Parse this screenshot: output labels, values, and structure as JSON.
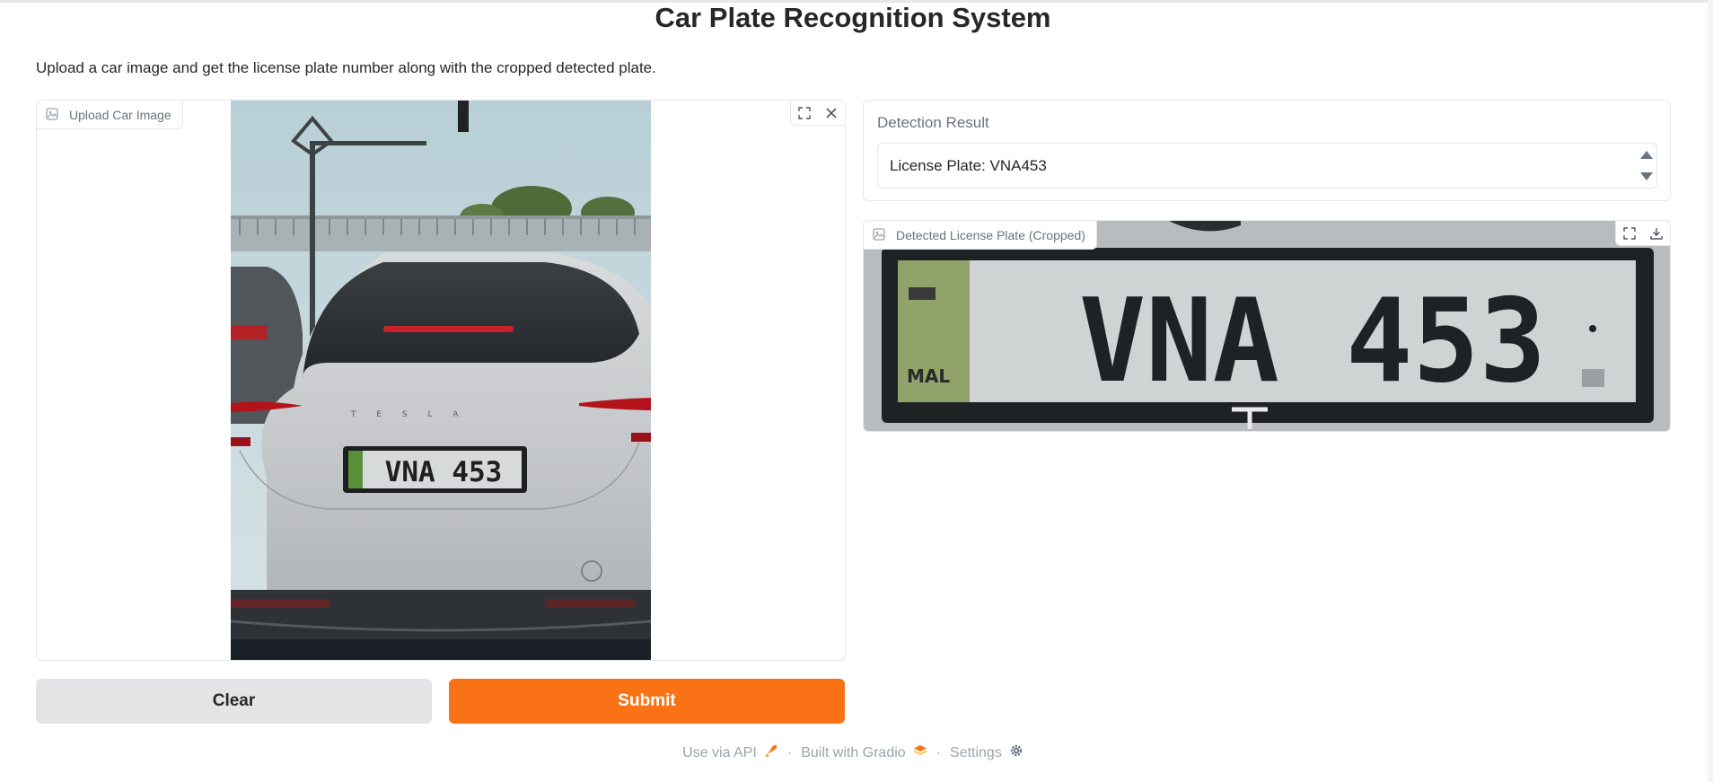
{
  "page": {
    "title": "Car Plate Recognition System",
    "description": "Upload a car image and get the license plate number along with the cropped detected plate."
  },
  "upload": {
    "label": "Upload Car Image",
    "image_alt": "Rear view of a silver Tesla with plate VNA 453",
    "car_plate_text": "VNA 453",
    "car_badge_text": "T E S L A"
  },
  "result": {
    "label": "Detection Result",
    "value": "License Plate: VNA453"
  },
  "cropped": {
    "label": "Detected License Plate (Cropped)",
    "plate_text": "VNA 453",
    "sticker_text": "MAL"
  },
  "buttons": {
    "clear": "Clear",
    "submit": "Submit"
  },
  "footer": {
    "api": "Use via API",
    "built": "Built with Gradio",
    "settings": "Settings",
    "separator": "·"
  },
  "colors": {
    "primary": "#f97316",
    "secondary": "#e4e4e7",
    "border": "#e5e7eb",
    "muted_text": "#6b7280"
  }
}
